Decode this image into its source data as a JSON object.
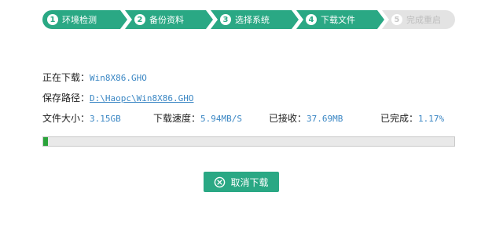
{
  "steps": [
    {
      "num": "1",
      "label": "环境检测",
      "state": "done"
    },
    {
      "num": "2",
      "label": "备份资料",
      "state": "done"
    },
    {
      "num": "3",
      "label": "选择系统",
      "state": "done"
    },
    {
      "num": "4",
      "label": "下载文件",
      "state": "active"
    },
    {
      "num": "5",
      "label": "完成重启",
      "state": "pending"
    }
  ],
  "download": {
    "file_label": "正在下载：",
    "file_name": "Win8X86.GHO",
    "path_label": "保存路径：",
    "path_value": "D:\\Haopc\\Win8X86.GHO",
    "size_label": "文件大小：",
    "size_value": "3.15GB",
    "speed_label": "下载速度：",
    "speed_value": "5.94MB/S",
    "received_label": "已接收：",
    "received_value": "37.69MB",
    "done_label": "已完成：",
    "done_value": "1.17%",
    "progress_percent": 1.17
  },
  "actions": {
    "cancel_label": "取消下载"
  },
  "colors": {
    "accent": "#2aa884",
    "progress": "#2aa33b",
    "value_text": "#3b87c4",
    "inactive_step": "#e3e3e3"
  }
}
